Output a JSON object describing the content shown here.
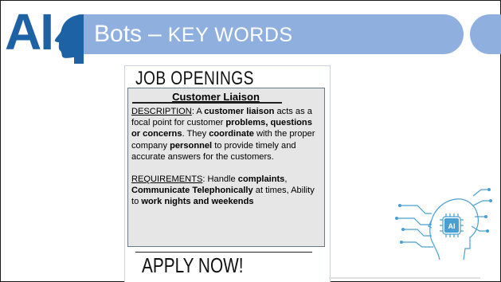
{
  "slide": {
    "logo_text": "AI",
    "title": "Bots",
    "title_dash": "–",
    "title_keywords": "KEY WORDS"
  },
  "poster": {
    "heading": "JOB OPENINGS",
    "job_title": "Customer Liaison",
    "description_label": "DESCRIPTION",
    "description_text": [
      {
        "t": ": A "
      },
      {
        "t": "customer liaison",
        "b": true
      },
      {
        "t": " acts as a focal point for customer "
      },
      {
        "t": "problems, questions or concerns",
        "b": true
      },
      {
        "t": ". They "
      },
      {
        "t": "coordinate",
        "b": true
      },
      {
        "t": " with the proper company "
      },
      {
        "t": "personnel",
        "b": true
      },
      {
        "t": " to provide timely and accurate answers for the customers."
      }
    ],
    "requirements_label": "REQUIREMENTS",
    "requirements_text": [
      {
        "t": ": Handle "
      },
      {
        "t": "complaints",
        "b": true
      },
      {
        "t": ", "
      },
      {
        "t": "Communicate Telephonically",
        "b": true
      },
      {
        "t": " at times, Ability to "
      },
      {
        "t": "work nights and weekends",
        "b": true
      }
    ],
    "cta": "APPLY NOW!"
  },
  "decor": {
    "ai_chip_label": "AI",
    "accent_color": "#8fb0df",
    "logo_color": "#1d62a5",
    "circuit_color": "#4a9fd1",
    "icons": [
      "ai-head-profile-icon",
      "ai-chip-head-icon"
    ]
  }
}
